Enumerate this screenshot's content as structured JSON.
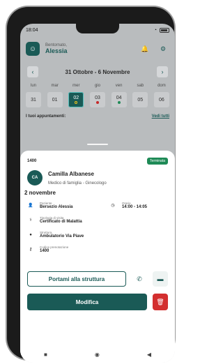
{
  "status": {
    "time": "18:04",
    "battery": "81"
  },
  "header": {
    "welcome": "Bentornato,",
    "user_name": "Alessia"
  },
  "calendar": {
    "range": "31 Ottobre - 6 Novembre",
    "days": [
      "lun",
      "mar",
      "mer",
      "gio",
      "ven",
      "sab",
      "dom"
    ],
    "dates": [
      "31",
      "01",
      "02",
      "03",
      "04",
      "05",
      "06"
    ],
    "selected_index": 2,
    "dots": {
      "mer": "#f0c419",
      "gio": "#c62828",
      "ven": "#1e8a56"
    }
  },
  "appointments": {
    "title": "I tuoi appuntamenti:",
    "view_all": "Vedi tutti"
  },
  "detail": {
    "code": "1400",
    "status": "Terminata",
    "doctor_initials": "CA",
    "doctor_name": "Camilla Albanese",
    "doctor_specialty": "Medico di famiglia - Ginecologo",
    "date": "2 novembre",
    "patient_label": "Paziente",
    "patient_value": "Bersezio Alessia",
    "time_label": "Orario",
    "time_value": "14:00 - 14:05",
    "visit_label": "Tipologia di visita",
    "visit_value": "Certificato di Malattia",
    "structure_label": "Struttura",
    "structure_value": "Ambulatorio Via Piave",
    "booking_label": "Codice prenotazione",
    "booking_value": "1400",
    "go_button": "Portami alla struttura",
    "edit_button": "Modifica"
  },
  "colors": {
    "primary": "#1a5a56",
    "danger": "#d32f2f",
    "success": "#1e8a56"
  },
  "icons": [
    "wifi-icon",
    "battery-icon",
    "bell-icon",
    "settings-icon",
    "person-icon",
    "clock-icon",
    "visit-icon",
    "location-icon",
    "key-icon",
    "phone-icon",
    "chat-icon",
    "trash-icon",
    "chevron-left-icon",
    "chevron-right-icon",
    "nav-square-icon",
    "nav-circle-icon",
    "nav-back-icon"
  ]
}
